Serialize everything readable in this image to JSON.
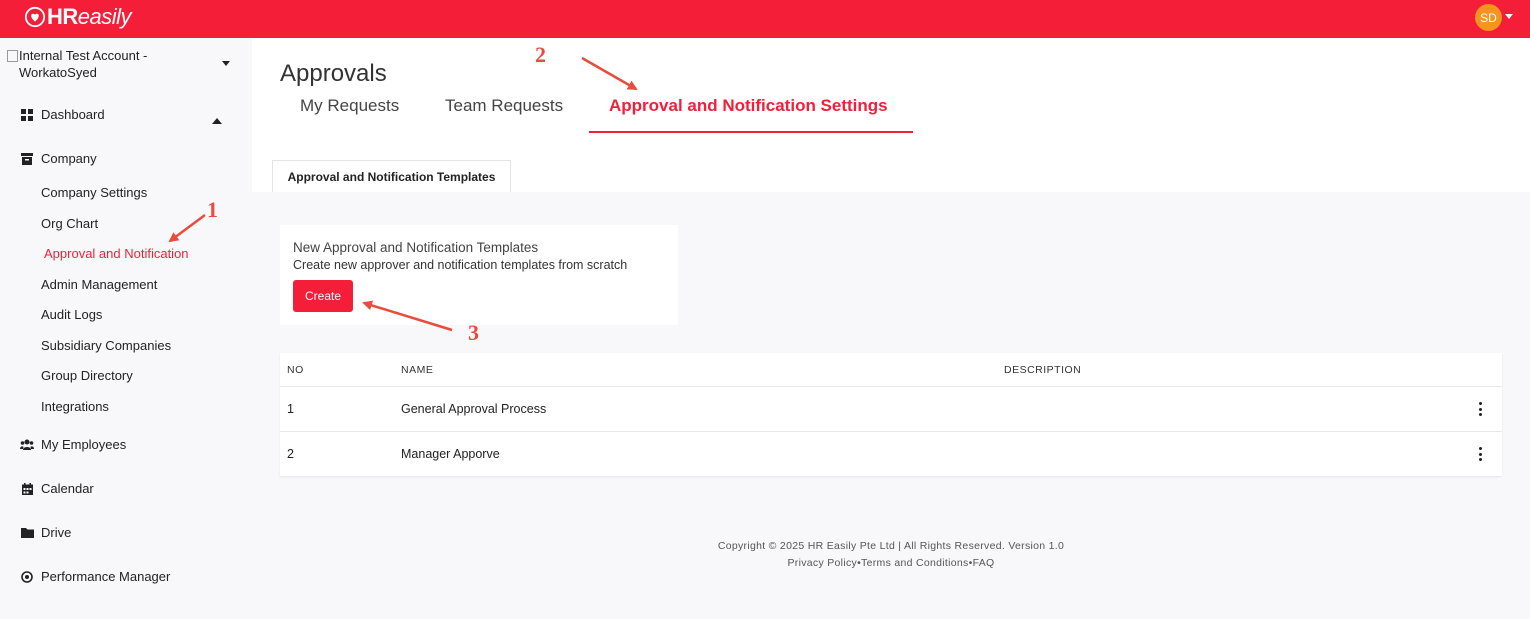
{
  "app": {
    "logo_text_bold": "HR",
    "logo_text_light": "easily",
    "user_initials": "SD",
    "brand_color": "#f51e38",
    "avatar_color": "#f7941d"
  },
  "sidebar": {
    "account_name": "Internal Test Account - WorkatoSyed",
    "items": [
      {
        "label": "Dashboard",
        "icon": "grid-icon"
      },
      {
        "label": "Company",
        "icon": "archive-icon"
      },
      {
        "label": "My Employees",
        "icon": "users-icon"
      },
      {
        "label": "Calendar",
        "icon": "calendar-icon"
      },
      {
        "label": "Drive",
        "icon": "folder-icon"
      },
      {
        "label": "Performance Manager",
        "icon": "target-icon"
      }
    ],
    "company_sub": [
      "Company Settings",
      "Org Chart",
      "Approval and Notification",
      "Admin Management",
      "Audit Logs",
      "Subsidiary Companies",
      "Group Directory",
      "Integrations"
    ]
  },
  "main": {
    "title": "Approvals",
    "tabs": [
      "My Requests",
      "Team Requests",
      "Approval and Notification Settings"
    ],
    "subtab": "Approval and Notification Templates",
    "card": {
      "title": "New Approval and Notification Templates",
      "description": "Create new approver and notification templates from scratch",
      "button": "Create"
    },
    "table": {
      "headers": [
        "NO",
        "NAME",
        "DESCRIPTION"
      ],
      "rows": [
        {
          "no": "1",
          "name": "General Approval Process",
          "description": ""
        },
        {
          "no": "2",
          "name": "Manager Apporve",
          "description": ""
        }
      ]
    }
  },
  "footer": {
    "copyright": "Copyright © 2025 HR Easily Pte Ltd | All Rights Reserved. Version 1.0",
    "privacy": "Privacy Policy",
    "sep": "•",
    "terms": "Terms and Conditions",
    "faq": "FAQ"
  },
  "annotations": {
    "one": "1",
    "two": "2",
    "three": "3",
    "color": "#e74c3c"
  }
}
